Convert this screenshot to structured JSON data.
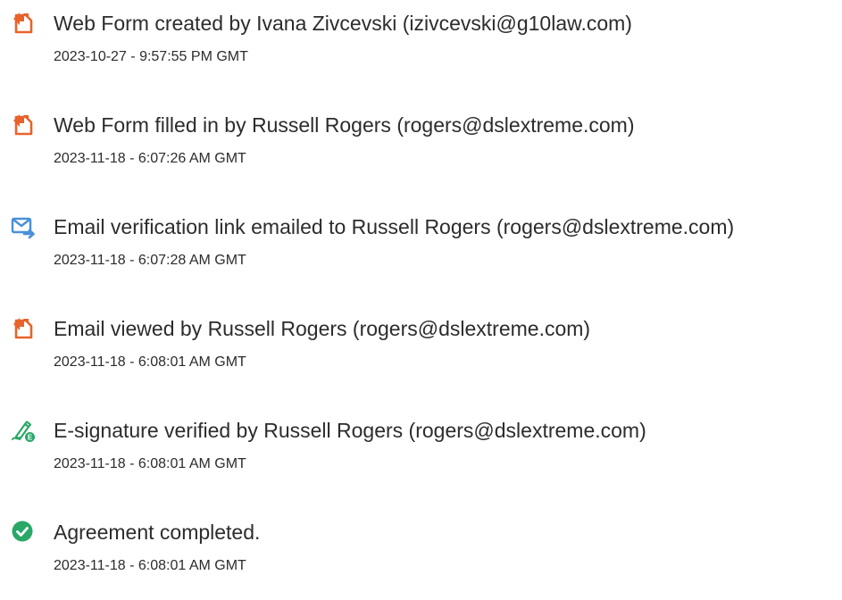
{
  "events": [
    {
      "icon": "web-form-icon",
      "title": "Web Form created by Ivana Zivcevski (izivcevski@g10law.com)",
      "timestamp": "2023-10-27 - 9:57:55 PM GMT"
    },
    {
      "icon": "web-form-icon",
      "title": "Web Form filled in by Russell Rogers (rogers@dslextreme.com)",
      "timestamp": "2023-11-18 - 6:07:26 AM GMT"
    },
    {
      "icon": "email-send-icon",
      "title": "Email verification link emailed to Russell Rogers (rogers@dslextreme.com)",
      "timestamp": "2023-11-18 - 6:07:28 AM GMT"
    },
    {
      "icon": "web-form-icon",
      "title": "Email viewed by Russell Rogers (rogers@dslextreme.com)",
      "timestamp": "2023-11-18 - 6:08:01 AM GMT"
    },
    {
      "icon": "e-signature-icon",
      "title": "E-signature verified by Russell Rogers (rogers@dslextreme.com)",
      "timestamp": "2023-11-18 - 6:08:01 AM GMT"
    },
    {
      "icon": "check-circle-icon",
      "title": "Agreement completed.",
      "timestamp": "2023-11-18 - 6:08:01 AM GMT"
    }
  ],
  "colors": {
    "text": "#2c2c2c",
    "web_form_icon": "#e8632b",
    "email_icon": "#4a90d9",
    "signature_icon": "#2aa867",
    "check_icon": "#2aa867"
  }
}
